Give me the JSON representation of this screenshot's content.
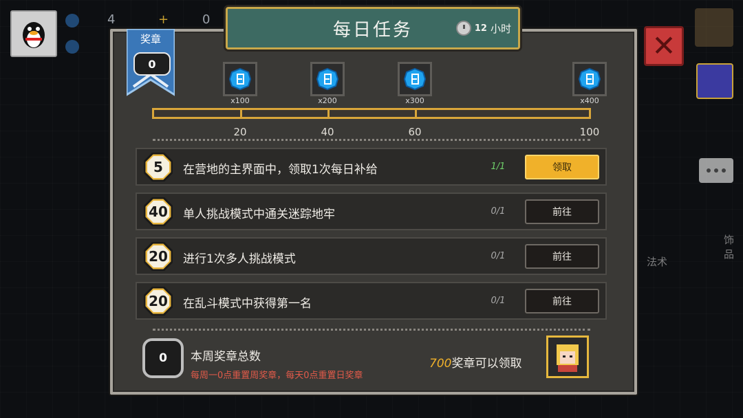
{
  "hud": {
    "gem_count": "4",
    "plus_sign": "+",
    "box_count": "0"
  },
  "dialog": {
    "title": "每日任务",
    "timer": {
      "value": "12",
      "unit": "小时"
    },
    "medal": {
      "label": "奖章",
      "value": "0"
    },
    "rewards": [
      {
        "qty": "x100",
        "icon": "blue-gem-icon"
      },
      {
        "qty": "x200",
        "icon": "blue-gem-icon"
      },
      {
        "qty": "x300",
        "icon": "blue-gem-icon"
      },
      {
        "qty": "x400",
        "icon": "blue-gem-icon"
      }
    ],
    "progress": {
      "current": 0,
      "max": 100,
      "ticks": [
        "20",
        "40",
        "60",
        "100"
      ]
    },
    "tasks": [
      {
        "points": "5",
        "description": "在营地的主界面中，领取1次每日补给",
        "progress": "1/1",
        "button": "领取",
        "state": "claim"
      },
      {
        "points": "40",
        "description": "单人挑战模式中通关迷踪地牢",
        "progress": "0/1",
        "button": "前往",
        "state": "goto"
      },
      {
        "points": "20",
        "description": "进行1次多人挑战模式",
        "progress": "0/1",
        "button": "前往",
        "state": "goto"
      },
      {
        "points": "20",
        "description": "在乱斗模式中获得第一名",
        "progress": "0/1",
        "button": "前往",
        "state": "goto"
      }
    ],
    "weekly": {
      "value": "0",
      "title": "本周奖章总数",
      "note": "每周一0点重置周奖章，每天0点重置日奖章",
      "claimable_num": "700",
      "claimable_text": "奖章可以领取"
    }
  },
  "background": {
    "side_label_1": "饰品",
    "side_label_2": "法术"
  },
  "colors": {
    "accent_gold": "#f0b12a",
    "banner_teal": "#3d6a62",
    "done_green": "#6fd06a",
    "note_red": "#e25a4a"
  }
}
